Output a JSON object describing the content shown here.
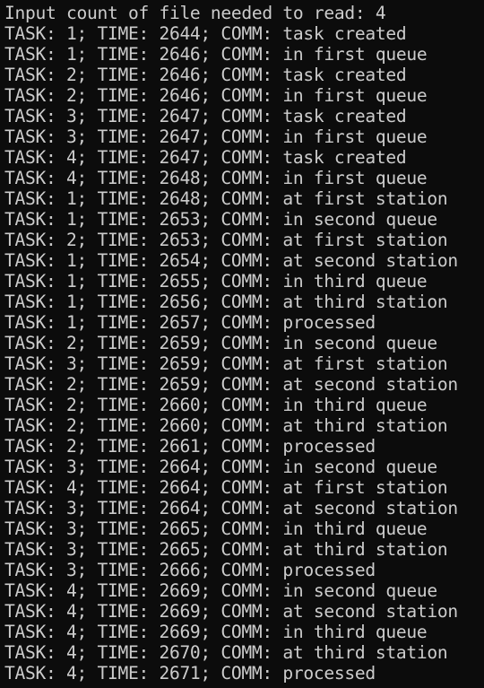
{
  "terminal": {
    "lines": [
      "Input count of file needed to read: 4",
      "TASK: 1; TIME: 2644; COMM: task created",
      "TASK: 1; TIME: 2646; COMM: in first queue",
      "TASK: 2; TIME: 2646; COMM: task created",
      "TASK: 2; TIME: 2646; COMM: in first queue",
      "TASK: 3; TIME: 2647; COMM: task created",
      "TASK: 3; TIME: 2647; COMM: in first queue",
      "TASK: 4; TIME: 2647; COMM: task created",
      "TASK: 4; TIME: 2648; COMM: in first queue",
      "TASK: 1; TIME: 2648; COMM: at first station",
      "TASK: 1; TIME: 2653; COMM: in second queue",
      "TASK: 2; TIME: 2653; COMM: at first station",
      "TASK: 1; TIME: 2654; COMM: at second station",
      "TASK: 1; TIME: 2655; COMM: in third queue",
      "TASK: 1; TIME: 2656; COMM: at third station",
      "TASK: 1; TIME: 2657; COMM: processed",
      "TASK: 2; TIME: 2659; COMM: in second queue",
      "TASK: 3; TIME: 2659; COMM: at first station",
      "TASK: 2; TIME: 2659; COMM: at second station",
      "TASK: 2; TIME: 2660; COMM: in third queue",
      "TASK: 2; TIME: 2660; COMM: at third station",
      "TASK: 2; TIME: 2661; COMM: processed",
      "TASK: 3; TIME: 2664; COMM: in second queue",
      "TASK: 4; TIME: 2664; COMM: at first station",
      "TASK: 3; TIME: 2664; COMM: at second station",
      "TASK: 3; TIME: 2665; COMM: in third queue",
      "TASK: 3; TIME: 2665; COMM: at third station",
      "TASK: 3; TIME: 2666; COMM: processed",
      "TASK: 4; TIME: 2669; COMM: in second queue",
      "TASK: 4; TIME: 2669; COMM: at second station",
      "TASK: 4; TIME: 2669; COMM: in third queue",
      "TASK: 4; TIME: 2670; COMM: at third station",
      "TASK: 4; TIME: 2671; COMM: processed"
    ]
  },
  "colors": {
    "background": "#0c0c0c",
    "foreground": "#cccccc"
  }
}
